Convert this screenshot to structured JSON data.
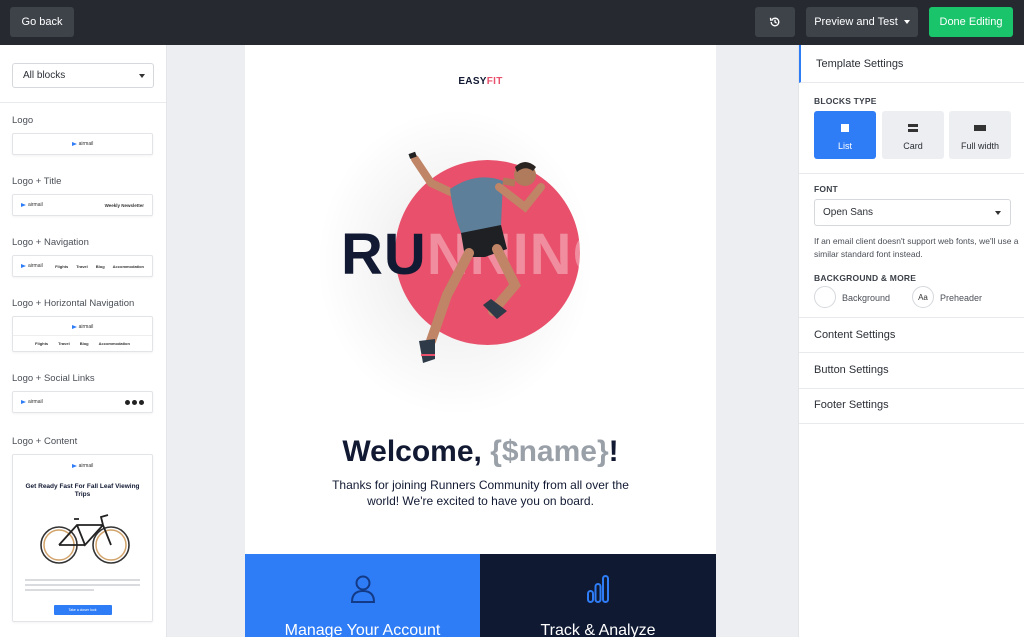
{
  "topbar": {
    "back_label": "Go back",
    "history_icon": "history-icon",
    "preview_label": "Preview and Test",
    "done_label": "Done Editing",
    "colors": {
      "bar": "#262a30",
      "button": "#3e434a",
      "done": "#19c46a"
    }
  },
  "left": {
    "filter": "All blocks",
    "blocks": [
      {
        "label": "Logo",
        "logo": "airmail"
      },
      {
        "label": "Logo + Title",
        "logo": "airmail",
        "title": "Weekly Newsletter"
      },
      {
        "label": "Logo + Navigation",
        "logo": "airmail",
        "nav": [
          "Flights",
          "Travel",
          "Blog",
          "Accommodation"
        ]
      },
      {
        "label": "Logo + Horizontal Navigation",
        "logo": "airmail",
        "nav": [
          "Flights",
          "Travel",
          "Blog",
          "Accommodation"
        ]
      },
      {
        "label": "Logo + Social Links",
        "logo": "airmail"
      },
      {
        "label": "Logo + Content",
        "logo": "airmail",
        "headline": "Get Ready Fast For Fall Leaf Viewing Trips",
        "button": "Take a closer look"
      }
    ]
  },
  "canvas": {
    "brand_a": "EASY",
    "brand_b": "FIT",
    "hero_word_left": "RU",
    "hero_word_mid": "NN",
    "hero_word_right": "ING",
    "welcome_pre": "Welcome, ",
    "welcome_var": "{$name}",
    "welcome_post": "!",
    "thanks": "Thanks for joining Runners Community from all over the world! We're excited to have you on board.",
    "features": [
      {
        "title": "Manage Your Account",
        "icon": "user-icon"
      },
      {
        "title": "Track & Analyze",
        "icon": "bar-chart-icon"
      }
    ],
    "colors": {
      "accent": "#e8506b",
      "navy": "#121a33",
      "blue": "#2f7df6",
      "dark": "#0f1932"
    }
  },
  "right": {
    "header": "Template Settings",
    "blocks_type_label": "BLOCKS TYPE",
    "block_types": [
      {
        "label": "List",
        "active": true
      },
      {
        "label": "Card",
        "active": false
      },
      {
        "label": "Full width",
        "active": false
      }
    ],
    "font_label": "FONT",
    "font_value": "Open Sans",
    "font_note": "If an email client doesn't support web fonts, we'll use a similar standard font instead.",
    "bg_label": "BACKGROUND & MORE",
    "background_label": "Background",
    "preheader_label": "Preheader",
    "preheader_glyph": "Aa",
    "sections": [
      "Content Settings",
      "Button Settings",
      "Footer Settings"
    ]
  }
}
